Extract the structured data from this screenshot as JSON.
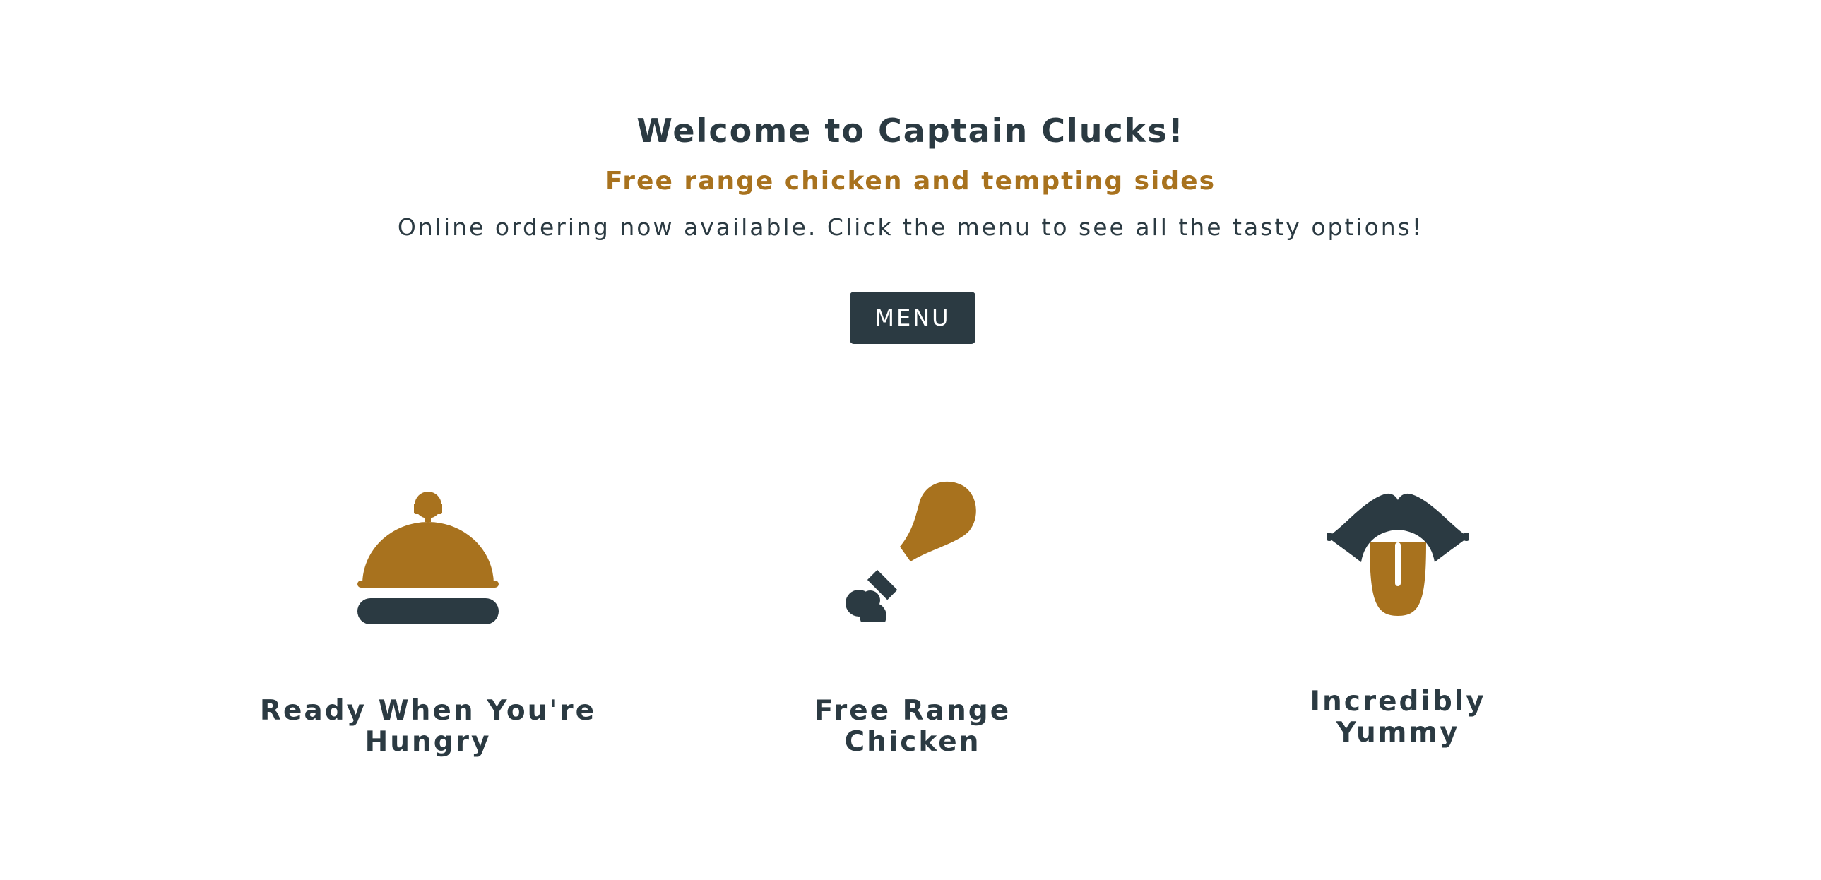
{
  "hero": {
    "title": "Welcome to Captain Clucks!",
    "subtitle": "Free range chicken and tempting sides",
    "text": "Online ordering now available. Click the menu to see all the tasty options!",
    "menu_button": "MENU"
  },
  "features": [
    {
      "icon": "service-bell-icon",
      "label_line1": "Ready When You're",
      "label_line2": "Hungry"
    },
    {
      "icon": "drumstick-icon",
      "label_line1": "Free Range",
      "label_line2": "Chicken"
    },
    {
      "icon": "mouth-tongue-icon",
      "label_line1": "Incredibly",
      "label_line2": "Yummy"
    }
  ],
  "colors": {
    "dark": "#2b3a42",
    "accent": "#a8721e",
    "background": "#ffffff"
  }
}
